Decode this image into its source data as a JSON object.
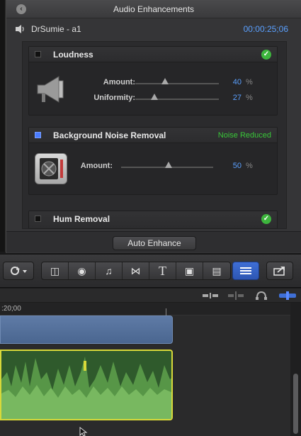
{
  "panel": {
    "title": "Audio Enhancements",
    "clip_name": "DrSumie - a1",
    "timecode": "00:00:25;06"
  },
  "loudness": {
    "title": "Loudness",
    "amount_label": "Amount:",
    "amount_value": "40",
    "uniformity_label": "Uniformity:",
    "uniformity_value": "27",
    "unit": "%"
  },
  "noise": {
    "title": "Background Noise Removal",
    "status": "Noise Reduced",
    "amount_label": "Amount:",
    "amount_value": "50",
    "unit": "%"
  },
  "hum": {
    "title": "Hum Removal"
  },
  "auto_enhance_label": "Auto Enhance",
  "timeline": {
    "ruler_time": ":20;00"
  },
  "colors": {
    "accent": "#4a7cff",
    "value_blue": "#5aa0ff",
    "ok_green": "#3db53d",
    "clip_outline": "#d8d83a"
  }
}
